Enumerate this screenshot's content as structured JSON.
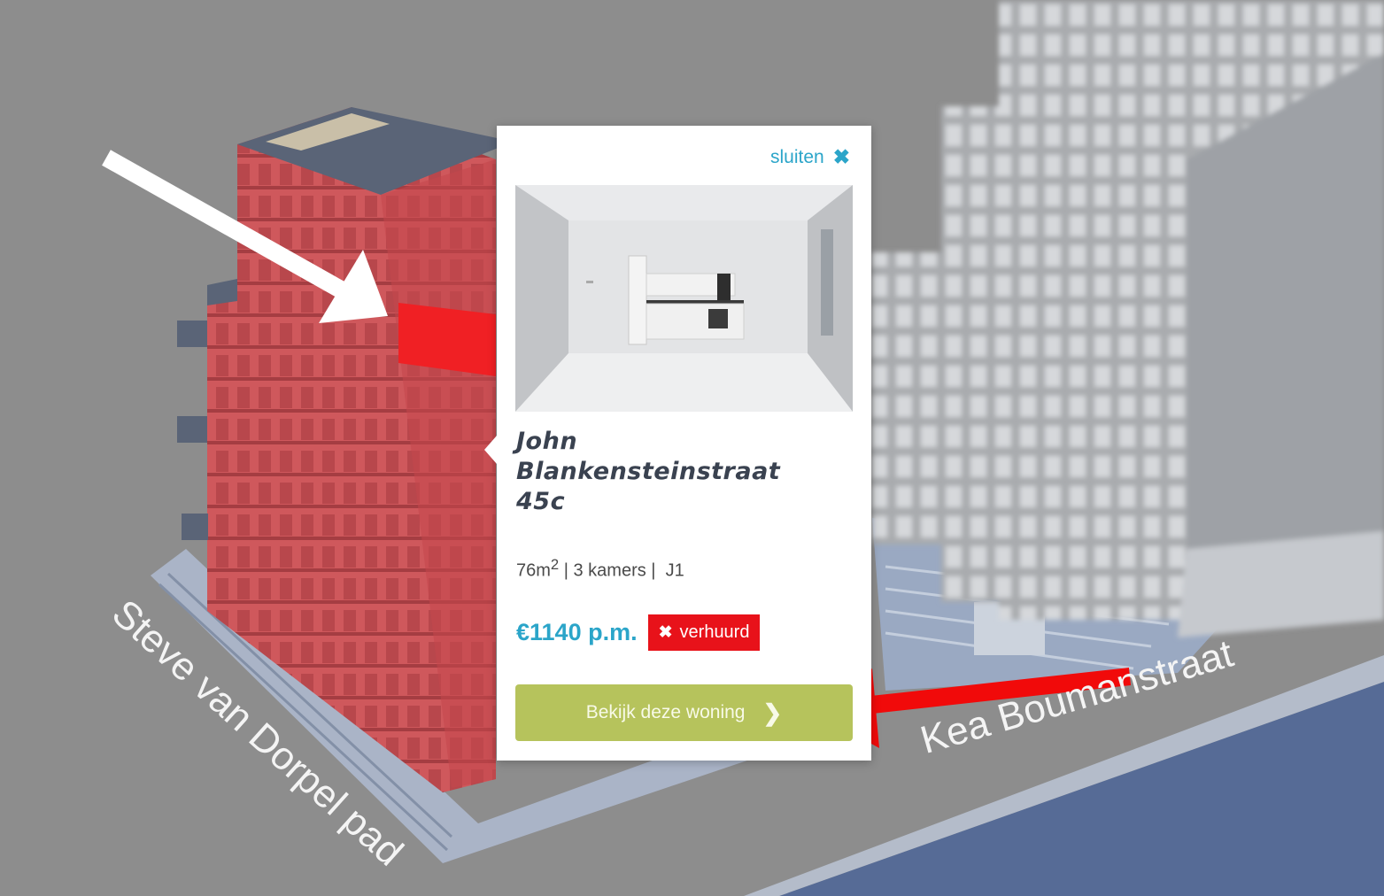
{
  "streets": {
    "left": "Steve van Dorpel pad",
    "right": "Kea Boumanstraat"
  },
  "popup": {
    "close_label": "sluiten",
    "close_icon": "✖",
    "title_line1": "John",
    "title_line2": "Blankensteinstraat",
    "title_line3": "45c",
    "specs_area": "76m",
    "specs_area_sup": "2",
    "specs_rest": " | 3 kamers |  J1",
    "price": "€1140 p.m.",
    "status_icon": "✖",
    "status_label": "verhuurd",
    "button_label": "Bekijk deze woning",
    "button_icon": "❯"
  },
  "colors": {
    "accent_blue": "#2ba5c9",
    "status_red": "#e8121a",
    "button_green": "#b6c35c",
    "highlight_building": "#d05a5e",
    "annotation_arrow_red": "#f10a0a",
    "annotation_arrow_white": "#ffffff"
  }
}
